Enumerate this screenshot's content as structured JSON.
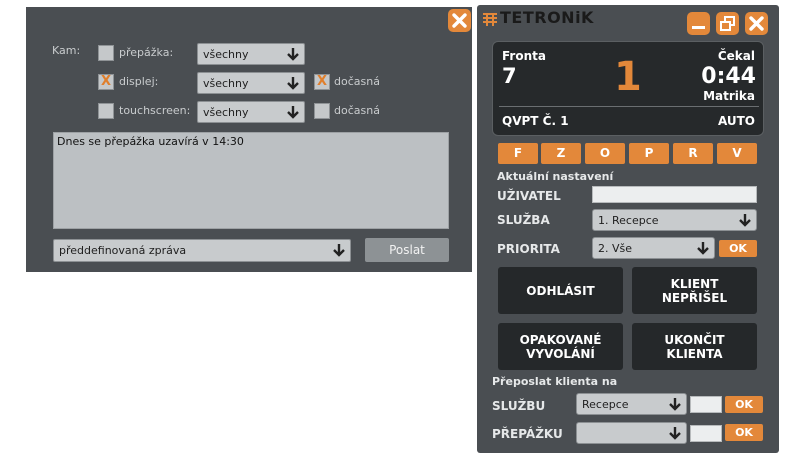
{
  "message_panel": {
    "kam_label": "Kam:",
    "targets": [
      {
        "label": "přepážka:",
        "checked": false,
        "select_value": "všechny",
        "temp_label": ""
      },
      {
        "label": "displej:",
        "checked": true,
        "select_value": "všechny",
        "temp_label": "dočasná",
        "temp_checked": true
      },
      {
        "label": "touchscreen:",
        "checked": false,
        "select_value": "všechny",
        "temp_label": "dočasná",
        "temp_checked": false
      }
    ],
    "message_text": "Dnes se přepážka uzavírá v 14:30",
    "predefined_select": "předdefinovaná zpráva",
    "send_label": "Poslat",
    "check_mark": "X"
  },
  "tetronik": {
    "logo_text": "TETRONiK",
    "queue_label": "Fronta",
    "queue_value": "7",
    "current_number": "1",
    "waited_label": "Čekal",
    "waited_value": "0:44",
    "service_name": "Matrika",
    "counter_label": "QVPT Č. 1",
    "mode_label": "AUTO",
    "letter_buttons": [
      "F",
      "Z",
      "O",
      "P",
      "R",
      "V"
    ],
    "settings_title": "Aktuální nastavení",
    "user_label": "UŽIVATEL",
    "user_value": "",
    "service_label": "SLUŽBA",
    "service_value": "1. Recepce",
    "priority_label": "PRIORITA",
    "priority_value": "2. Vše",
    "ok_label": "OK",
    "btn_logout": "ODHLÁSIT",
    "btn_no_show_l1": "KLIENT",
    "btn_no_show_l2": "NEPŘIŠEL",
    "btn_recall_l1": "OPAKOVANÉ",
    "btn_recall_l2": "VYVOLÁNÍ",
    "btn_finish_l1": "UKONČIT",
    "btn_finish_l2": "KLIENTA",
    "forward_title": "Přeposlat klienta na",
    "forward_service_label": "SLUŽBU",
    "forward_service_value": "Recepce",
    "forward_counter_label": "PŘEPÁŽKU",
    "forward_counter_value": ""
  },
  "colors": {
    "accent": "#e3883a",
    "panel": "#4a4e52",
    "display": "#26292b"
  }
}
